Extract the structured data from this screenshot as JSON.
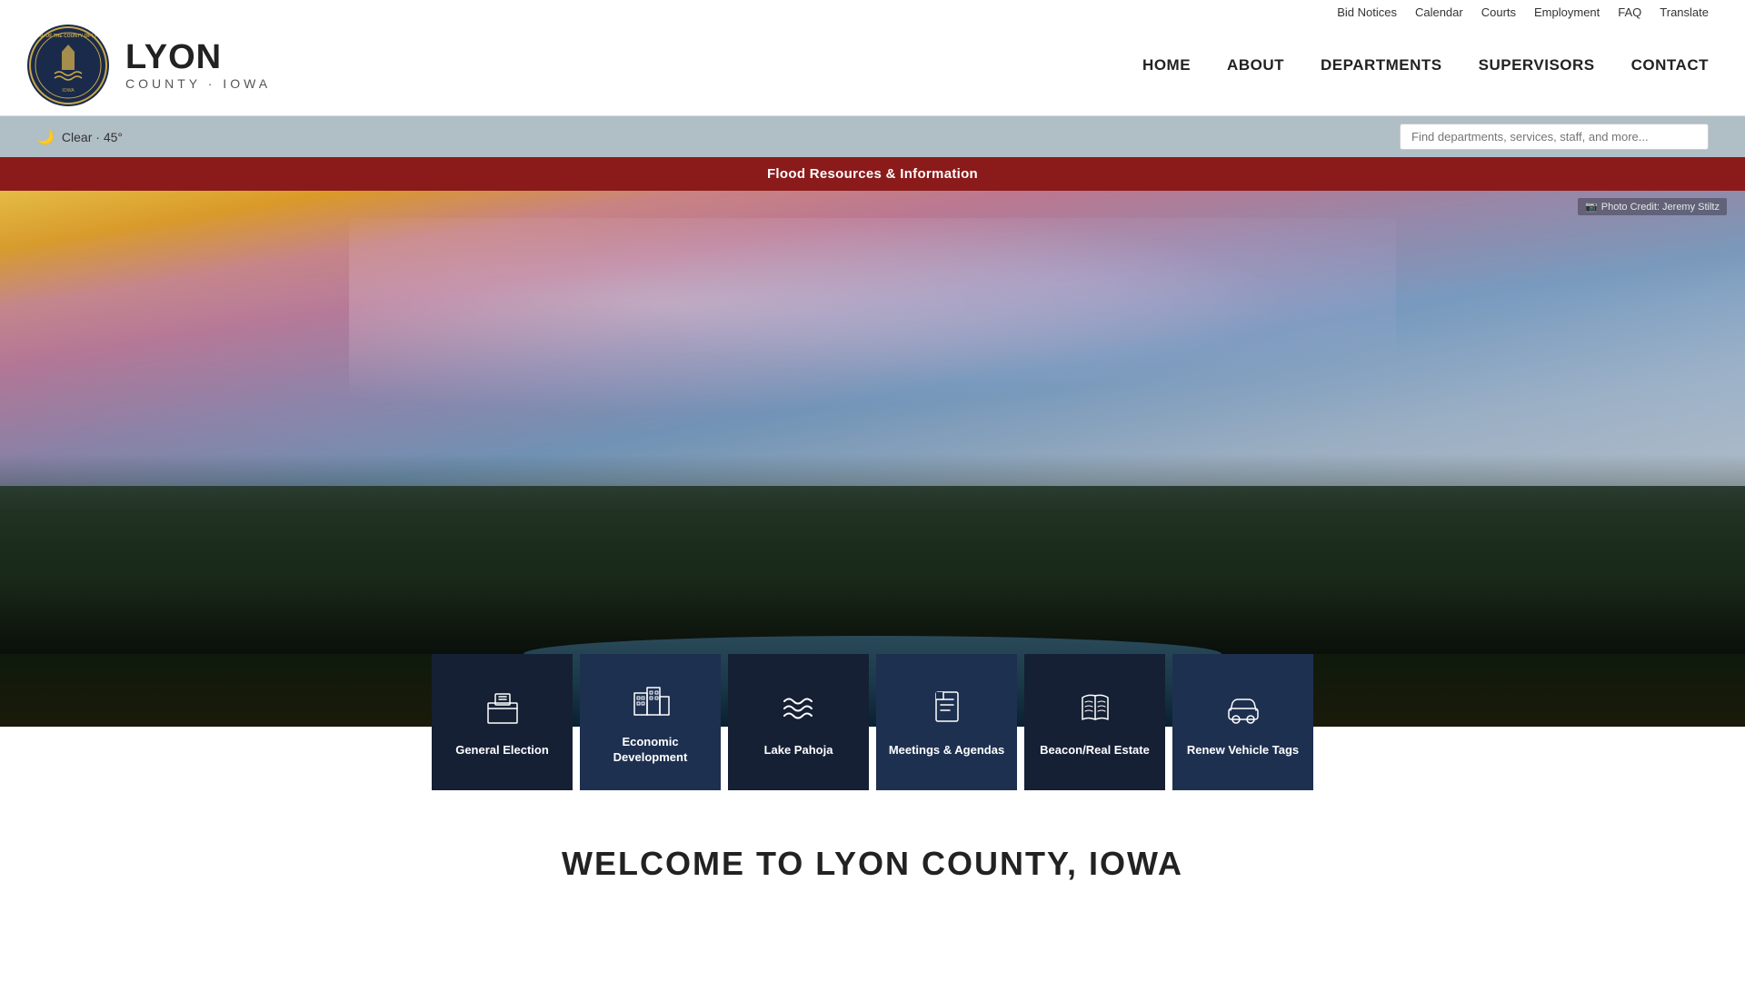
{
  "utility": {
    "links": [
      "Bid Notices",
      "Calendar",
      "Courts",
      "Employment",
      "FAQ",
      "Translate"
    ]
  },
  "header": {
    "logo_line1": "LYON",
    "logo_line2": "COUNTY · IOWA",
    "nav": [
      "HOME",
      "ABOUT",
      "DEPARTMENTS",
      "SUPERVISORS",
      "CONTACT"
    ]
  },
  "weather": {
    "icon": "🌙",
    "text": "Clear · 45°"
  },
  "search": {
    "placeholder": "Find departments, services, staff, and more..."
  },
  "alert": {
    "text": "Flood Resources & Information"
  },
  "photo_credit": {
    "text": "Photo Credit: Jeremy Stiltz"
  },
  "quick_links": [
    {
      "label": "General Election",
      "icon": "election"
    },
    {
      "label": "Economic Development",
      "icon": "economic"
    },
    {
      "label": "Lake Pahoja",
      "icon": "lake"
    },
    {
      "label": "Meetings & Agendas",
      "icon": "meetings"
    },
    {
      "label": "Beacon/Real Estate",
      "icon": "beacon"
    },
    {
      "label": "Renew Vehicle Tags",
      "icon": "vehicle"
    }
  ],
  "welcome": {
    "title": "WELCOME TO LYON COUNTY, IOWA"
  }
}
